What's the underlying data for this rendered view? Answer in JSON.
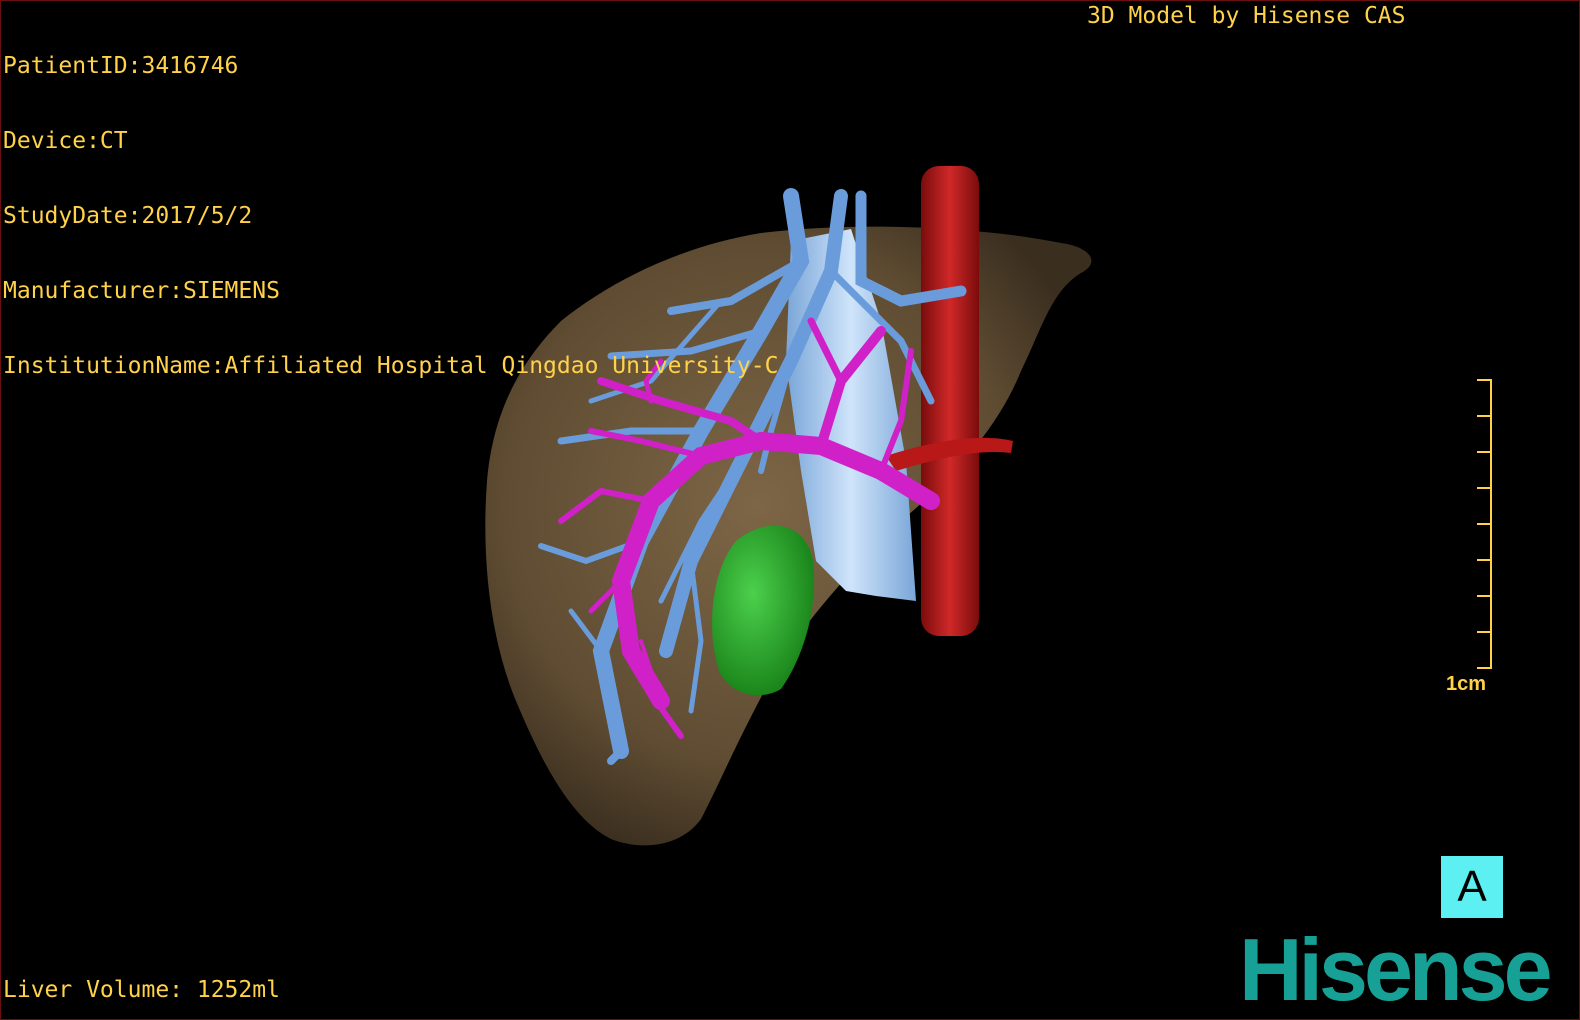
{
  "patient_info": {
    "patient_id": "PatientID:3416746",
    "device": "Device:CT",
    "study_date": "StudyDate:2017/5/2",
    "manufacturer": "Manufacturer:SIEMENS",
    "institution": "InstitutionName:Affiliated Hospital Qingdao University-C"
  },
  "brand_caption": "3D Model by Hisense CAS",
  "liver_volume": "Liver Volume: 1252ml",
  "scale_bar": {
    "label": "1cm"
  },
  "orientation_label": "A",
  "brand_logo": "Hisense",
  "colors": {
    "liver": "#6a5538",
    "portal_vein": "#6a9cdc",
    "hepatic_vein": "#d020c8",
    "ivc": "#a8ccf0",
    "aorta": "#b81818",
    "gallbladder": "#2aa82a",
    "overlay_text": "#ffd24a",
    "orientation_box": "#5df0f2",
    "logo": "#17a196"
  }
}
